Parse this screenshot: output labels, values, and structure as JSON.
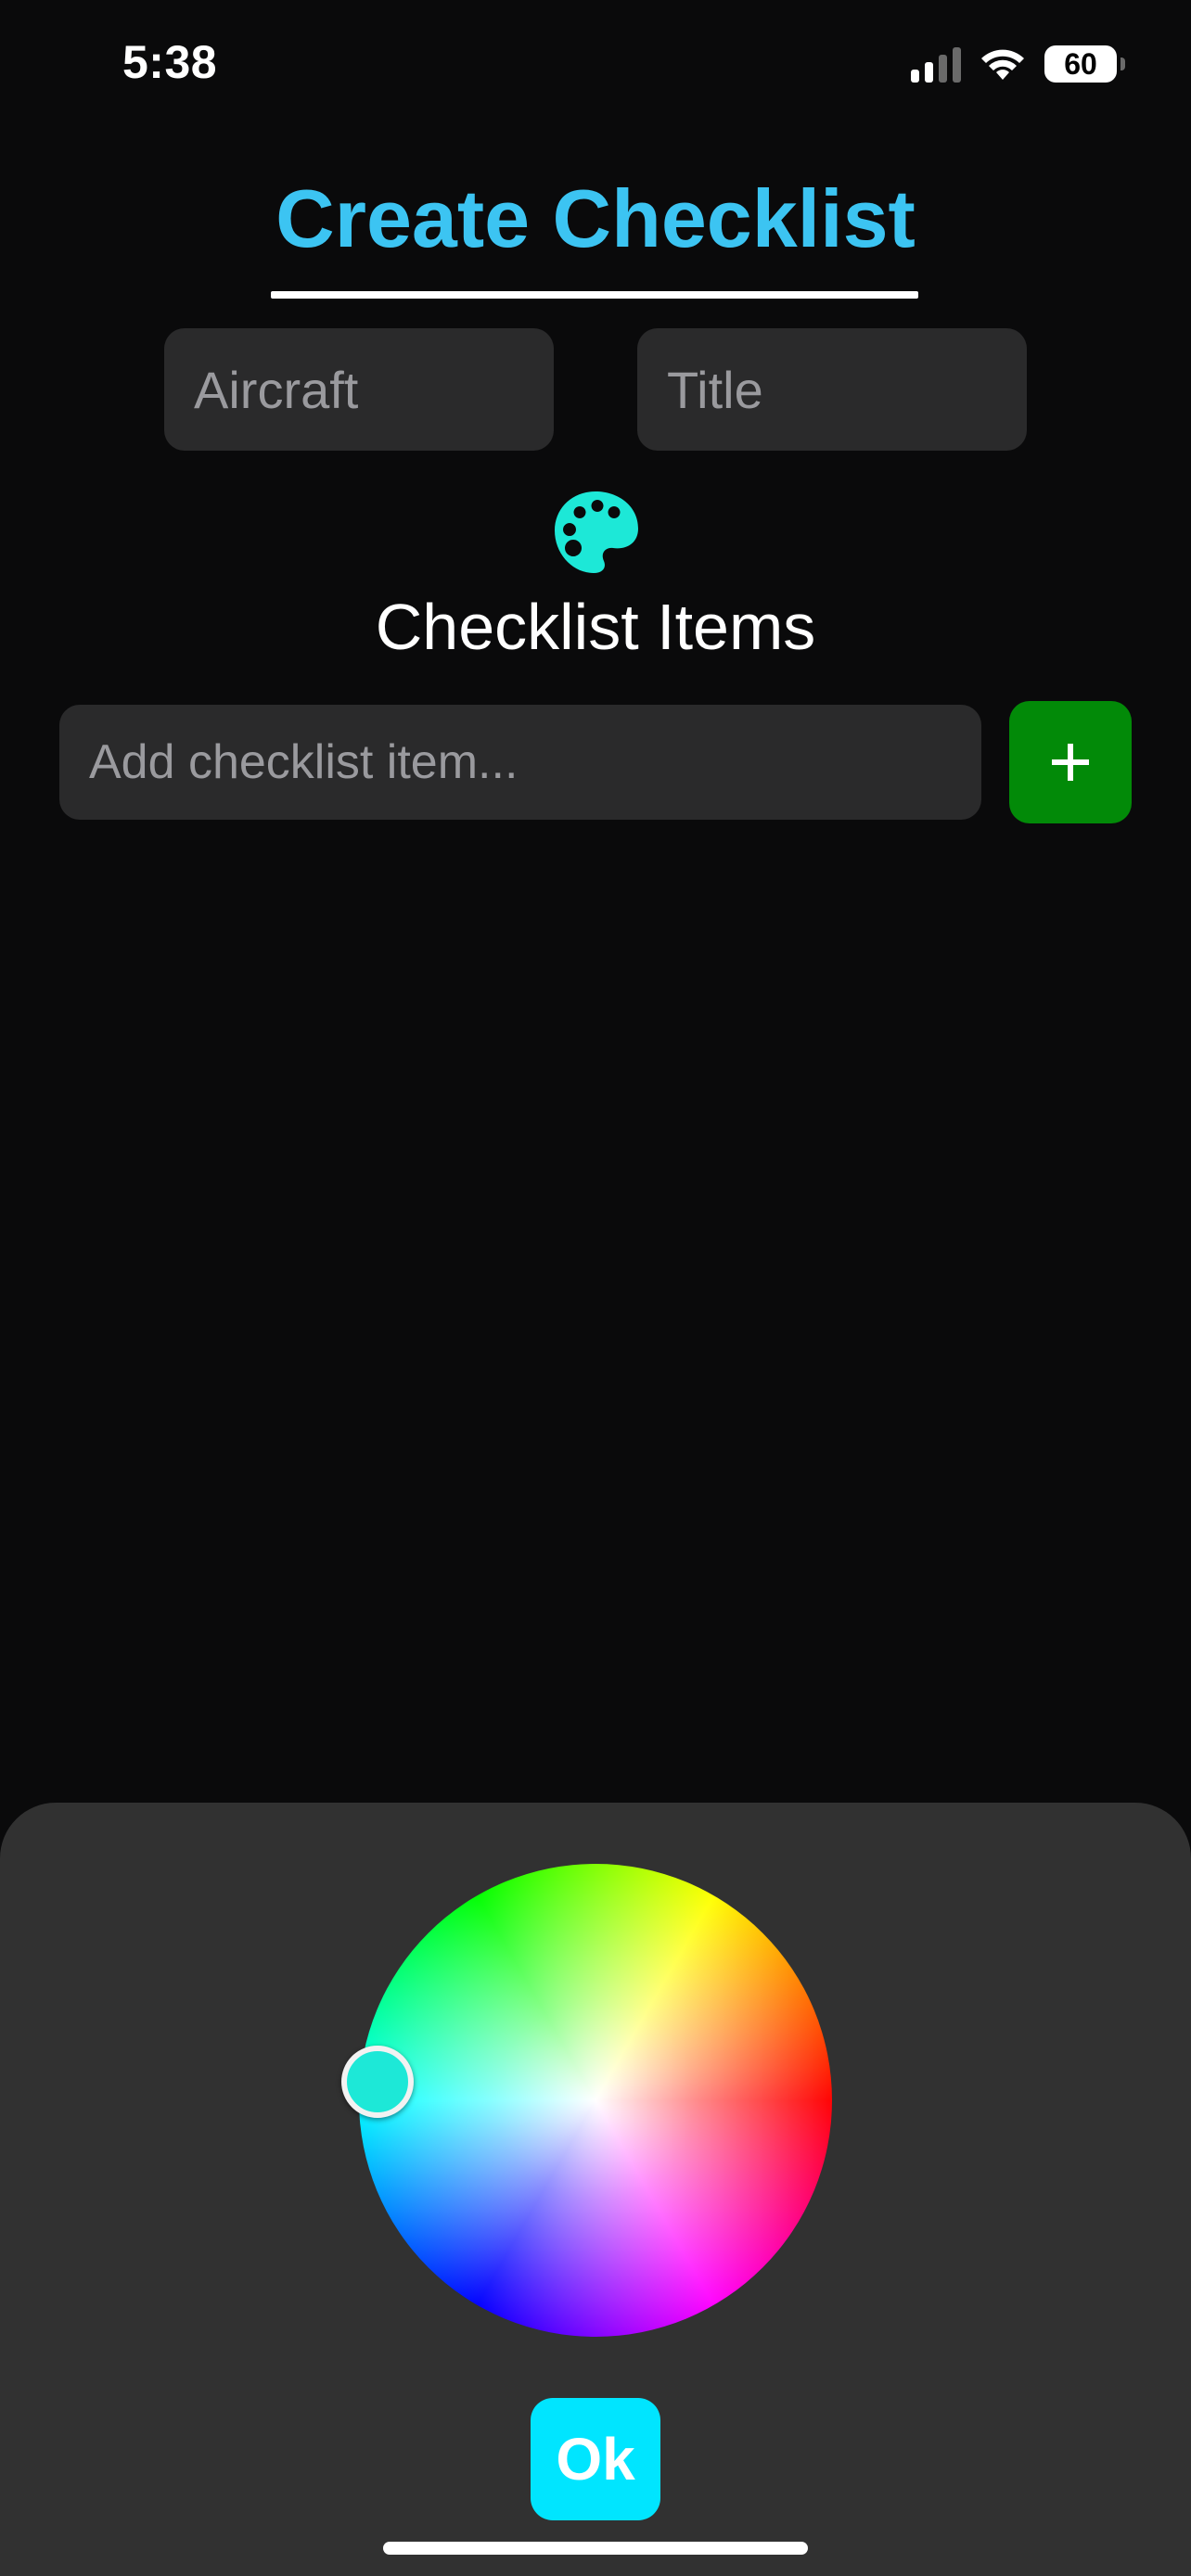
{
  "status_bar": {
    "time": "5:38",
    "battery_level": "60"
  },
  "header": {
    "title": "Create Checklist",
    "title_color": "#3cc4f2"
  },
  "form": {
    "aircraft": {
      "value": "",
      "placeholder": "Aircraft"
    },
    "title": {
      "value": "",
      "placeholder": "Title"
    }
  },
  "color_picker": {
    "icon": "palette-icon",
    "selected_color": "#1de8d7"
  },
  "checklist": {
    "section_label": "Checklist Items",
    "new_item": {
      "value": "",
      "placeholder": "Add checklist item..."
    },
    "add_icon": "plus-icon",
    "add_button_color": "#028a08",
    "items": []
  },
  "color_sheet": {
    "ok_label": "Ok",
    "ok_color": "#00e5ff"
  }
}
